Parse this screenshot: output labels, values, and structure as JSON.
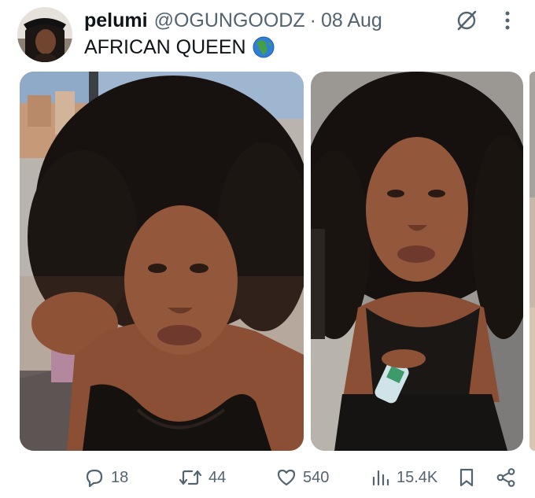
{
  "post": {
    "author": {
      "display_name": "pelumi",
      "handle": "@OGUNGOODZ",
      "separator": "·",
      "date": "08 Aug"
    },
    "text": "AFRICAN QUEEN",
    "emoji": "globe-africa-emoji",
    "header_icons": [
      "grok-icon",
      "more-vertical-icon"
    ]
  },
  "media": [
    {
      "kind": "photo"
    },
    {
      "kind": "photo"
    },
    {
      "kind": "photo"
    }
  ],
  "actions": {
    "replies": "18",
    "reposts": "44",
    "likes": "540",
    "views": "15.4K"
  },
  "colors": {
    "text": "#0f1419",
    "muted": "#536471",
    "background": "#ffffff"
  }
}
